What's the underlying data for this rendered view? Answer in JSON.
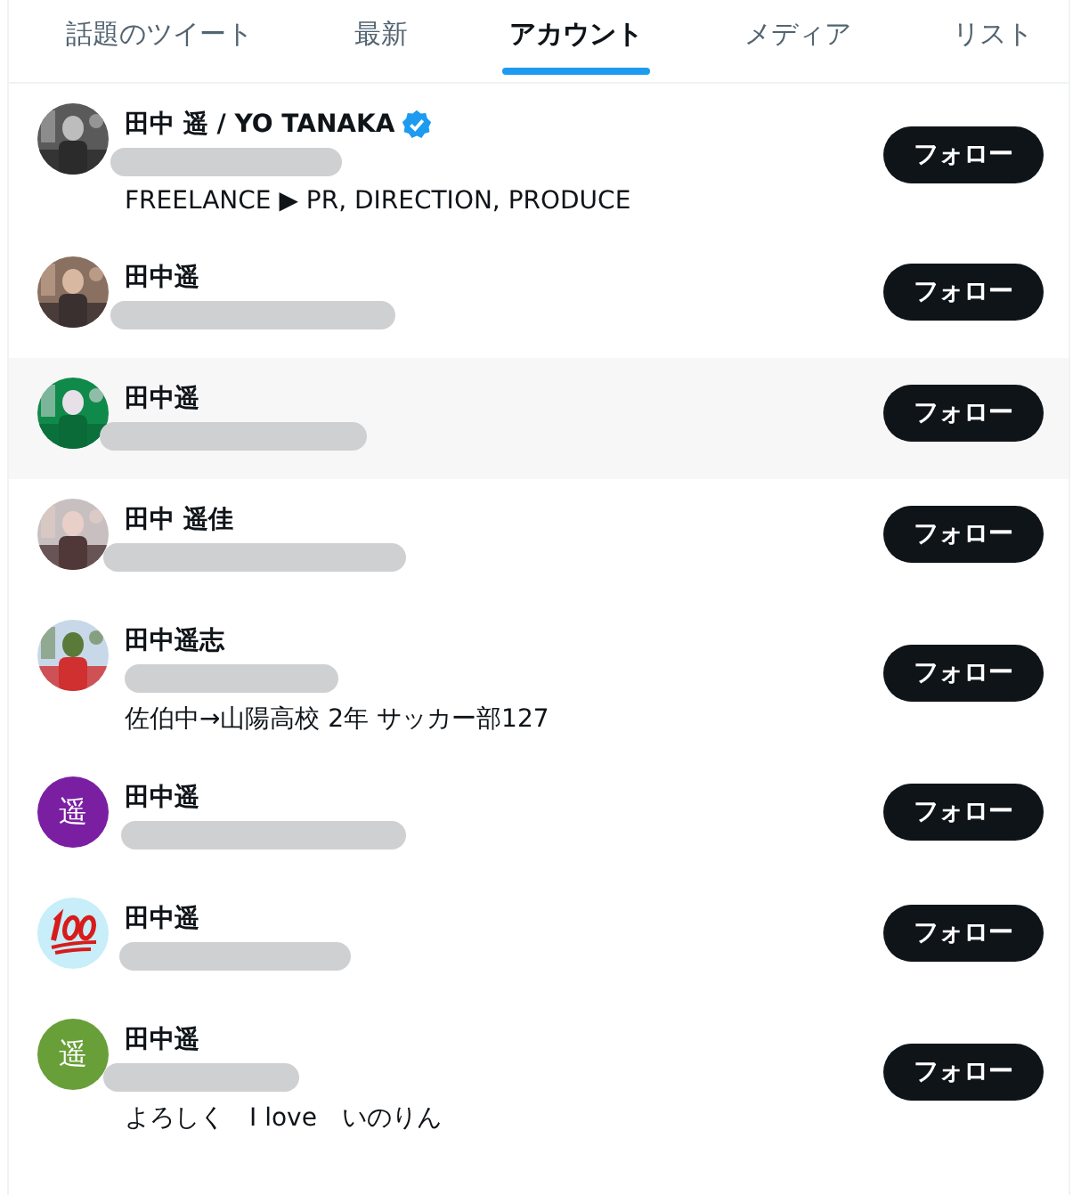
{
  "tabs": [
    {
      "label": "話題のツイート",
      "selected": false
    },
    {
      "label": "最新",
      "selected": false
    },
    {
      "label": "アカウント",
      "selected": true
    },
    {
      "label": "メディア",
      "selected": false
    },
    {
      "label": "リスト",
      "selected": false
    }
  ],
  "users": [
    {
      "name": "田中 遥 / YO TANAKA",
      "verified": true,
      "hovered": false,
      "handle_redacted": true,
      "bio": "FREELANCE ▶ PR, DIRECTION, PRODUCE",
      "button": "フォロー"
    },
    {
      "name": "田中遥",
      "verified": false,
      "hovered": false,
      "handle_redacted": true,
      "button": "フォロー"
    },
    {
      "name": "田中遥",
      "verified": false,
      "hovered": true,
      "handle_redacted": true,
      "button": "フォロー"
    },
    {
      "name": "田中 遥佳",
      "verified": false,
      "hovered": false,
      "handle_redacted": true,
      "button": "フォロー"
    },
    {
      "name": "田中遥志",
      "verified": false,
      "hovered": false,
      "handle_redacted": true,
      "bio": "佐伯中→山陽高校 2年 サッカー部127",
      "button": "フォロー"
    },
    {
      "name": "田中遥",
      "verified": false,
      "hovered": false,
      "handle_redacted": true,
      "avatar": {
        "kind": "letter",
        "letter": "遥",
        "color": "#7b1fa2"
      },
      "button": "フォロー"
    },
    {
      "name": "田中遥",
      "verified": false,
      "hovered": false,
      "handle_redacted": true,
      "avatar": {
        "kind": "emoji"
      },
      "button": "フォロー"
    },
    {
      "name": "田中遥",
      "verified": false,
      "hovered": false,
      "handle_redacted": true,
      "avatar": {
        "kind": "letter",
        "letter": "遥",
        "color": "#689f38"
      },
      "bio": "よろしく　I love　いのりん",
      "button": "フォロー"
    }
  ]
}
